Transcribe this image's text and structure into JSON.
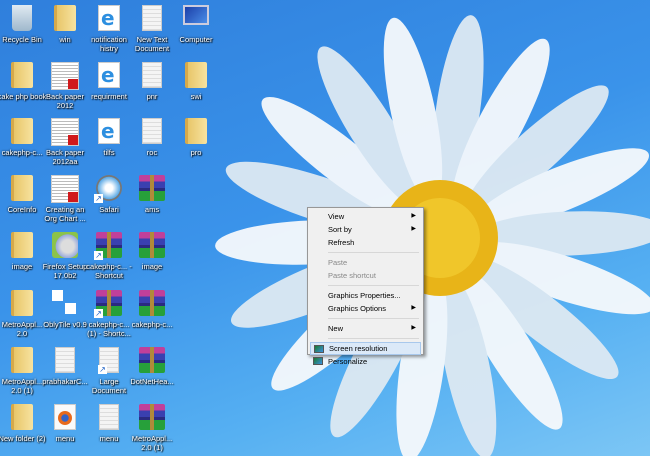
{
  "desktop_icons": [
    {
      "label": "Recycle Bin",
      "type": "recycle"
    },
    {
      "label": "win",
      "type": "folder"
    },
    {
      "label": "notification histry",
      "type": "ie"
    },
    {
      "label": "New Text Document",
      "type": "doc"
    },
    {
      "label": "Computer",
      "type": "computer"
    },
    {
      "label": "cake php book",
      "type": "folder"
    },
    {
      "label": "Back paper 2012",
      "type": "pdf"
    },
    {
      "label": "requirment",
      "type": "ie"
    },
    {
      "label": "pnr",
      "type": "doc"
    },
    {
      "label": "swi",
      "type": "folder"
    },
    {
      "label": "cakephp-c...",
      "type": "folder"
    },
    {
      "label": "Back paper 2012aa",
      "type": "pdf"
    },
    {
      "label": "tilfs",
      "type": "ie"
    },
    {
      "label": "roc",
      "type": "doc"
    },
    {
      "label": "pro",
      "type": "folder"
    },
    {
      "label": "CoreInfo",
      "type": "folder"
    },
    {
      "label": "Creating an Org Chart ...",
      "type": "pdf"
    },
    {
      "label": "Safari",
      "type": "safari",
      "shortcut": true
    },
    {
      "label": "ams",
      "type": "rar"
    },
    null,
    {
      "label": "image",
      "type": "folder"
    },
    {
      "label": "Firefox Setup 17.0b2",
      "type": "setup"
    },
    {
      "label": "cakephp-c... - Shortcut",
      "type": "rar",
      "shortcut": true
    },
    {
      "label": "image",
      "type": "rar"
    },
    null,
    {
      "label": "MetroAppl... 2.0",
      "type": "folder"
    },
    {
      "label": "OblyTile v0.9",
      "type": "tiles"
    },
    {
      "label": "cakephp-c... (1) - Shortc...",
      "type": "rar",
      "shortcut": true
    },
    {
      "label": "cakephp-c...",
      "type": "rar"
    },
    null,
    {
      "label": "MetroAppl... 2.0 (1)",
      "type": "folder"
    },
    {
      "label": "prabhakarC...",
      "type": "doc"
    },
    {
      "label": "Large Document",
      "type": "doc",
      "shortcut": true
    },
    {
      "label": "DotNetHea...",
      "type": "rar"
    },
    null,
    {
      "label": "New folder (2)",
      "type": "folder"
    },
    {
      "label": "menu",
      "type": "firefox"
    },
    {
      "label": "menu",
      "type": "doc"
    },
    {
      "label": "MetroAppl... 2.0 (1)",
      "type": "rar"
    },
    null
  ],
  "context_menu": {
    "items": [
      {
        "label": "View",
        "submenu": true
      },
      {
        "label": "Sort by",
        "submenu": true
      },
      {
        "label": "Refresh"
      },
      {
        "sep": true
      },
      {
        "label": "Paste",
        "disabled": true
      },
      {
        "label": "Paste shortcut",
        "disabled": true
      },
      {
        "sep": true
      },
      {
        "label": "Graphics Properties..."
      },
      {
        "label": "Graphics Options",
        "submenu": true
      },
      {
        "sep": true
      },
      {
        "label": "New",
        "submenu": true
      },
      {
        "sep": true
      },
      {
        "label": "Screen resolution",
        "icon": "screen-resolution-icon",
        "highlighted": true
      },
      {
        "label": "Personalize",
        "icon": "personalize-icon"
      }
    ]
  }
}
